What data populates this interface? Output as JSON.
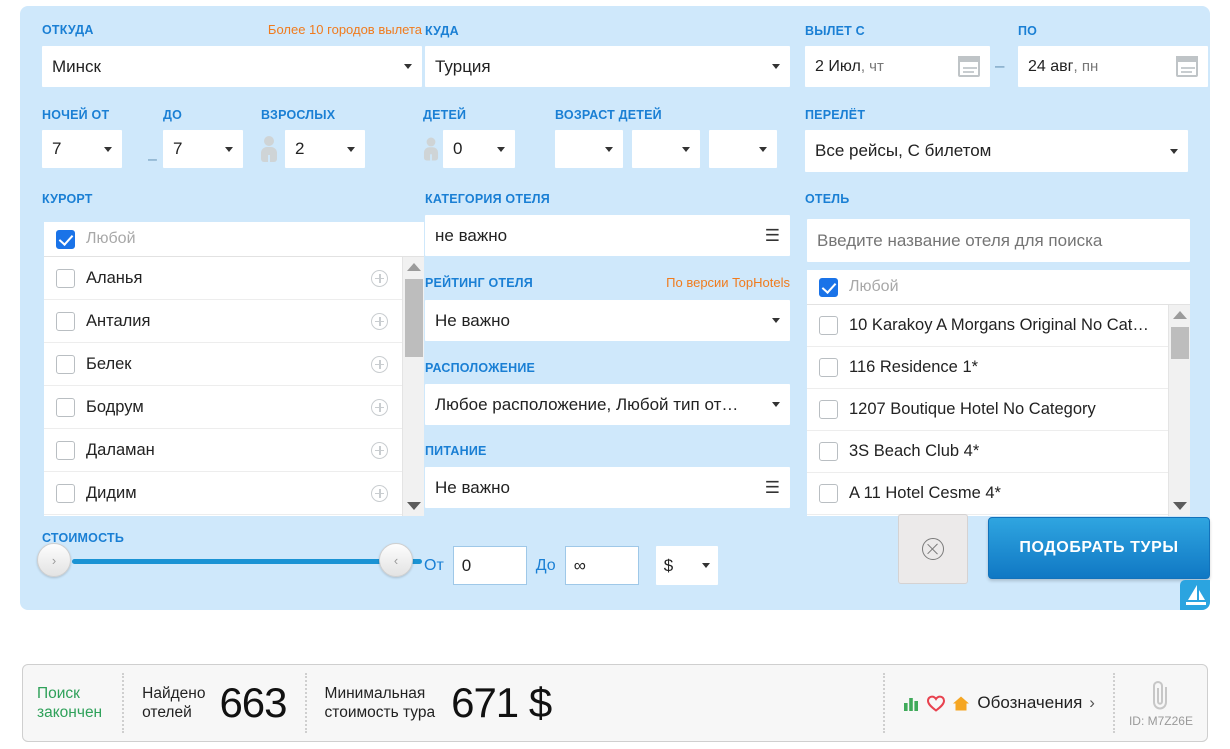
{
  "form": {
    "from": {
      "label": "ОТКУДА",
      "note": "Более 10 городов вылета",
      "value": "Минск"
    },
    "to": {
      "label": "КУДА",
      "value": "Турция"
    },
    "depart_from": {
      "label": "ВЫЛЕТ С",
      "date": "2 Июл",
      "weekday": ", чт"
    },
    "depart_to": {
      "label": "ПО",
      "date": "24 авг",
      "weekday": ", пн"
    },
    "range_dash": "–",
    "nights_from": {
      "label": "НОЧЕЙ ОТ",
      "value": "7"
    },
    "nights_to": {
      "label": "ДО",
      "value": "7"
    },
    "adults": {
      "label": "ВЗРОСЛЫХ",
      "value": "2"
    },
    "children": {
      "label": "ДЕТЕЙ",
      "value": "0"
    },
    "children_age": {
      "label": "ВОЗРАСТ ДЕТЕЙ",
      "values": [
        "",
        "",
        ""
      ]
    },
    "flight": {
      "label": "ПЕРЕЛЁТ",
      "value": "Все рейсы, С билетом"
    },
    "resort": {
      "label": "КУРОРТ",
      "any": "Любой",
      "items": [
        "Аланья",
        "Анталия",
        "Белек",
        "Бодрум",
        "Даламан",
        "Дидим"
      ]
    },
    "hotel_category": {
      "label": "КАТЕГОРИЯ ОТЕЛЯ",
      "value": "не важно"
    },
    "hotel_rating": {
      "label": "РЕЙТИНГ ОТЕЛЯ",
      "note": "По версии TopHotels",
      "value": "Не важно"
    },
    "location": {
      "label": "РАСПОЛОЖЕНИЕ",
      "value": "Любое расположение, Любой тип от…"
    },
    "meals": {
      "label": "ПИТАНИЕ",
      "value": "Не важно"
    },
    "hotel": {
      "label": "ОТЕЛЬ",
      "placeholder": "Введите название отеля для поиска",
      "search_value": "",
      "any": "Любой",
      "items": [
        "10 Karakoy A Morgans Original No Cat…",
        "116 Residence 1*",
        "1207 Boutique Hotel No Category",
        "3S Beach Club 4*",
        "A 11 Hotel Cesme 4*"
      ]
    },
    "price": {
      "label": "СТОИМОСТЬ",
      "from_label": "От",
      "from_value": "0",
      "to_label": "До",
      "to_value": "∞",
      "currency": "$"
    },
    "reset_button": "",
    "search_button": "ПОДОБРАТЬ ТУРЫ"
  },
  "status": {
    "search_state_line1": "Поиск",
    "search_state_line2": "закончен",
    "found_line1": "Найдено",
    "found_line2": "отелей",
    "found_count": "663",
    "min_price_line1": "Минимальная",
    "min_price_line2": "стоимость тура",
    "min_price_value": "671 $",
    "legend": "Обозначения",
    "legend_chevron": "›",
    "id": "ID: M7Z26E"
  },
  "colors": {
    "panel_bg": "#cfe8fb",
    "label_blue": "#1a7fd4",
    "accent_orange": "#f07b1d",
    "checkbox_blue": "#1a73e8",
    "slider_blue": "#1a93d4",
    "status_green": "#2fa15a",
    "heart_red": "#e8424f",
    "house_orange": "#f5a623"
  }
}
